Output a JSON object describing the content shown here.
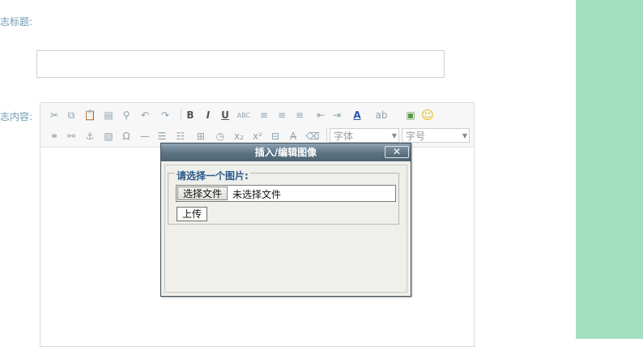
{
  "form": {
    "title_label": "志标题:",
    "content_label": "志内容:"
  },
  "toolbar": {
    "row1": [
      {
        "name": "cut-icon",
        "glyph": "✂"
      },
      {
        "name": "copy-icon",
        "glyph": "⧉"
      },
      {
        "name": "paste-icon",
        "glyph": "📋"
      },
      {
        "name": "paste-word-icon",
        "glyph": "▤"
      },
      {
        "name": "find-icon",
        "glyph": "⚲"
      },
      {
        "name": "undo-icon",
        "glyph": "↶"
      },
      {
        "name": "redo-icon",
        "glyph": "↷"
      },
      {
        "name": "bold-icon",
        "glyph": "B"
      },
      {
        "name": "italic-icon",
        "glyph": "I"
      },
      {
        "name": "underline-icon",
        "glyph": "U"
      },
      {
        "name": "strikethrough-icon",
        "glyph": "ABC"
      },
      {
        "name": "align-left-icon",
        "glyph": "≡"
      },
      {
        "name": "align-center-icon",
        "glyph": "≡"
      },
      {
        "name": "align-right-icon",
        "glyph": "≡"
      },
      {
        "name": "outdent-icon",
        "glyph": "⇤"
      },
      {
        "name": "indent-icon",
        "glyph": "⇥"
      },
      {
        "name": "font-color-icon",
        "glyph": "A"
      },
      {
        "name": "highlight-icon",
        "glyph": "ab"
      },
      {
        "name": "image-icon",
        "glyph": "▣"
      },
      {
        "name": "smiley-icon",
        "glyph": "☺"
      }
    ],
    "row2": [
      {
        "name": "link-icon",
        "glyph": "⚭"
      },
      {
        "name": "unlink-icon",
        "glyph": "⚯"
      },
      {
        "name": "anchor-icon",
        "glyph": "⚓"
      },
      {
        "name": "insert-image-icon",
        "glyph": "▨"
      },
      {
        "name": "special-char-icon",
        "glyph": "Ω"
      },
      {
        "name": "horizontal-rule-icon",
        "glyph": "—"
      },
      {
        "name": "bulleted-list-icon",
        "glyph": "☰"
      },
      {
        "name": "numbered-list-icon",
        "glyph": "☷"
      },
      {
        "name": "table-icon",
        "glyph": "⊞"
      },
      {
        "name": "time-icon",
        "glyph": "◷"
      },
      {
        "name": "subscript-icon",
        "glyph": "x₂"
      },
      {
        "name": "superscript-icon",
        "glyph": "x²"
      },
      {
        "name": "page-break-icon",
        "glyph": "⊟"
      },
      {
        "name": "remove-format-icon",
        "glyph": "A̶"
      },
      {
        "name": "eraser-icon",
        "glyph": "⌫"
      }
    ],
    "font_placeholder": "字体",
    "size_placeholder": "字号"
  },
  "dialog": {
    "title": "插入/编辑图像",
    "close_glyph": "✕",
    "legend": "请选择一个图片:",
    "choose_file_label": "选择文件",
    "file_status": "未选择文件",
    "upload_label": "上传"
  }
}
